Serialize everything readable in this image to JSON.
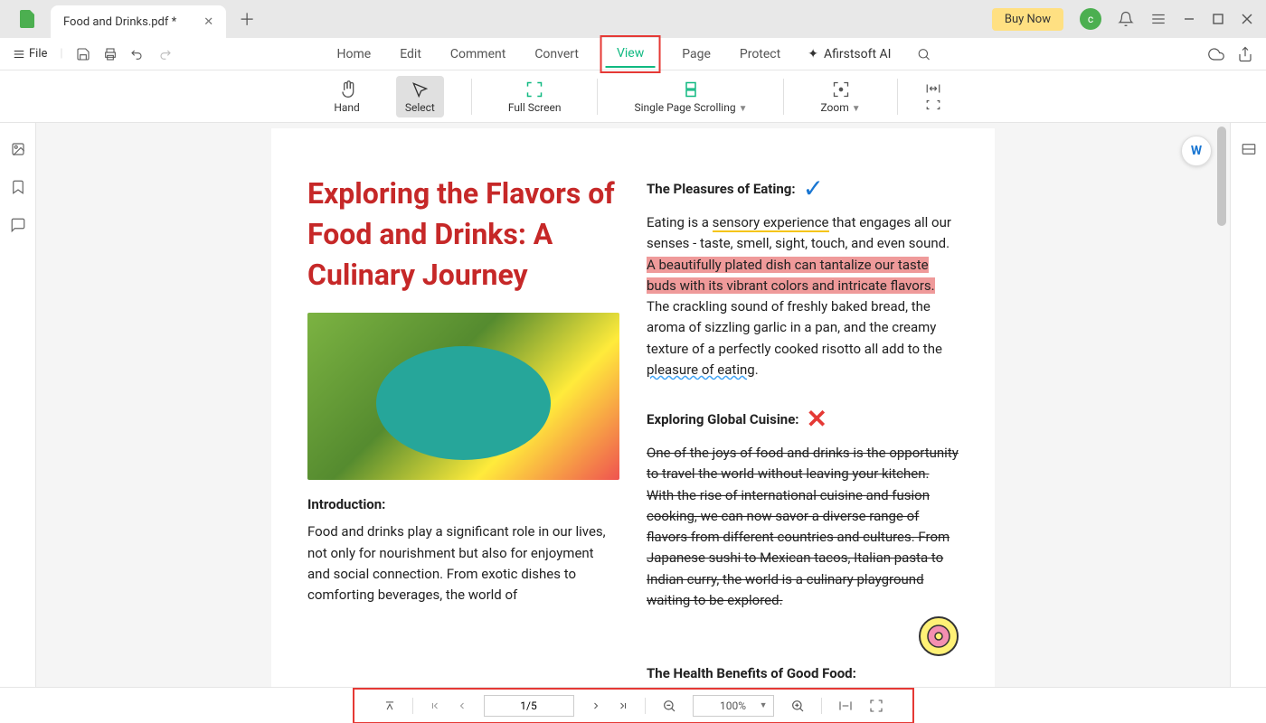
{
  "titlebar": {
    "tab_title": "Food and Drinks.pdf *",
    "buy_now": "Buy Now",
    "avatar_initial": "c"
  },
  "menubar": {
    "file": "File",
    "items": [
      "Home",
      "Edit",
      "Comment",
      "Convert",
      "View",
      "Page",
      "Protect"
    ],
    "active_index": 4,
    "ai_label": "Afirstsoft AI"
  },
  "toolbar": {
    "hand": "Hand",
    "select": "Select",
    "full_screen": "Full Screen",
    "single_page": "Single Page Scrolling",
    "zoom": "Zoom"
  },
  "document": {
    "title": "Exploring the Flavors of Food and Drinks: A Culinary Journey",
    "intro_heading": "Introduction:",
    "intro_body": "Food and drinks play a significant role in our lives, not only for nourishment but also for enjoyment and social connection. From exotic dishes to comforting beverages, the world of",
    "sec1_heading": "The Pleasures of Eating:",
    "sec1_part1": "Eating is a ",
    "sec1_underlined": "sensory experience",
    "sec1_part2": " that engages all our senses - taste, smell, sight, touch, and even sound. ",
    "sec1_highlight": "A beautifully plated dish can tantalize our taste buds with its vibrant colors and intricate flavors.",
    "sec1_part3": " The crackling sound of freshly baked bread, the aroma of sizzling garlic in a pan, and the creamy texture of a perfectly cooked risotto all add to the ",
    "sec1_wavy": "pleasure of eating",
    "sec1_part4": ".",
    "sec2_heading": "Exploring Global Cuisine:",
    "sec2_body": "One of the joys of food and drinks is the opportunity to travel the world without leaving your kitchen. With the rise of international cuisine and fusion cooking, we can now savor a diverse range of flavors from different countries and cultures. From Japanese sushi to Mexican tacos, Italian pasta to Indian curry, the world is a culinary playground waiting to be explored.",
    "sec3_heading": "The Health Benefits of Good Food:"
  },
  "statusbar": {
    "page": "1/5",
    "zoom": "100%"
  }
}
